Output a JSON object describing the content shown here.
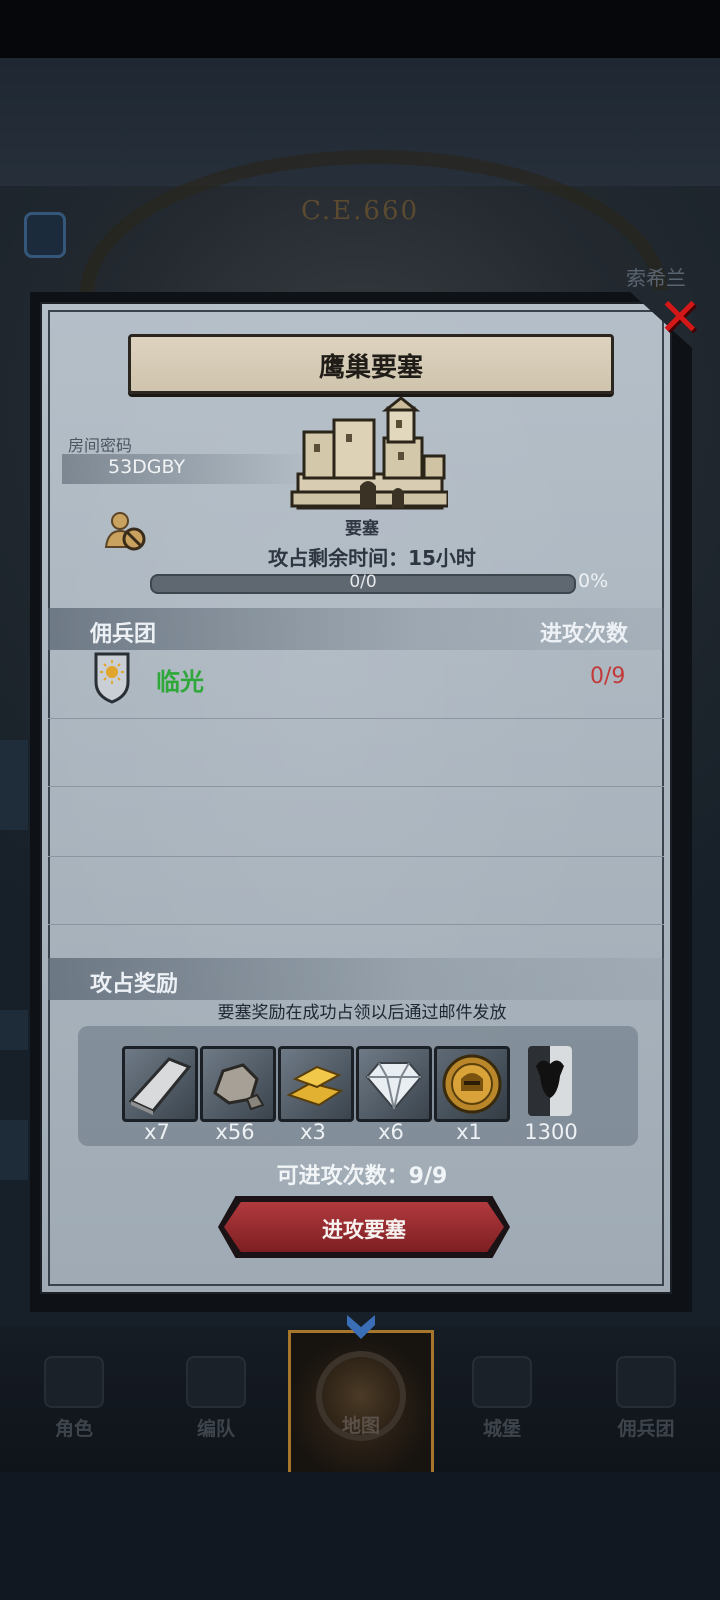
{
  "background": {
    "era_text": "C.E.660",
    "city_name": "索希兰"
  },
  "dialog": {
    "title": "鹰巢要塞",
    "room_label": "房间密码",
    "room_code": "53DGBY",
    "fortress_type": "要塞",
    "occupy_time_label": "攻占剩余时间：",
    "occupy_time_value": "15小时",
    "progress_text": "0/0",
    "progress_fraction": 0,
    "progress_percent": "0%",
    "mercenary_header": "佣兵团",
    "attack_count_header": "进攻次数",
    "mercenaries": [
      {
        "name": "临光",
        "attacks": "0/9"
      }
    ],
    "reward_header": "攻占奖励",
    "reward_note": "要塞奖励在成功占领以后通过邮件发放",
    "rewards": [
      {
        "icon": "iron-ingot-icon",
        "count": "x7"
      },
      {
        "icon": "ore-stone-icon",
        "count": "x56"
      },
      {
        "icon": "gold-bars-icon",
        "count": "x3"
      },
      {
        "icon": "diamond-icon",
        "count": "x6"
      },
      {
        "icon": "knight-helmet-coin-icon",
        "count": "x1"
      },
      {
        "icon": "bull-banner-icon",
        "count": "1300"
      }
    ],
    "attempts_label": "可进攻次数：",
    "attempts_value": "9/9",
    "attack_button": "进攻要塞"
  },
  "nav": {
    "items": [
      {
        "label": "角色"
      },
      {
        "label": "编队"
      },
      {
        "label": "地图"
      },
      {
        "label": "城堡"
      },
      {
        "label": "佣兵团"
      }
    ],
    "active": "地图"
  },
  "colors": {
    "close_red": "#d41818",
    "merc_green": "#2fa83a",
    "count_red": "#c23a3a",
    "attack_btn": "#9b2e32"
  }
}
